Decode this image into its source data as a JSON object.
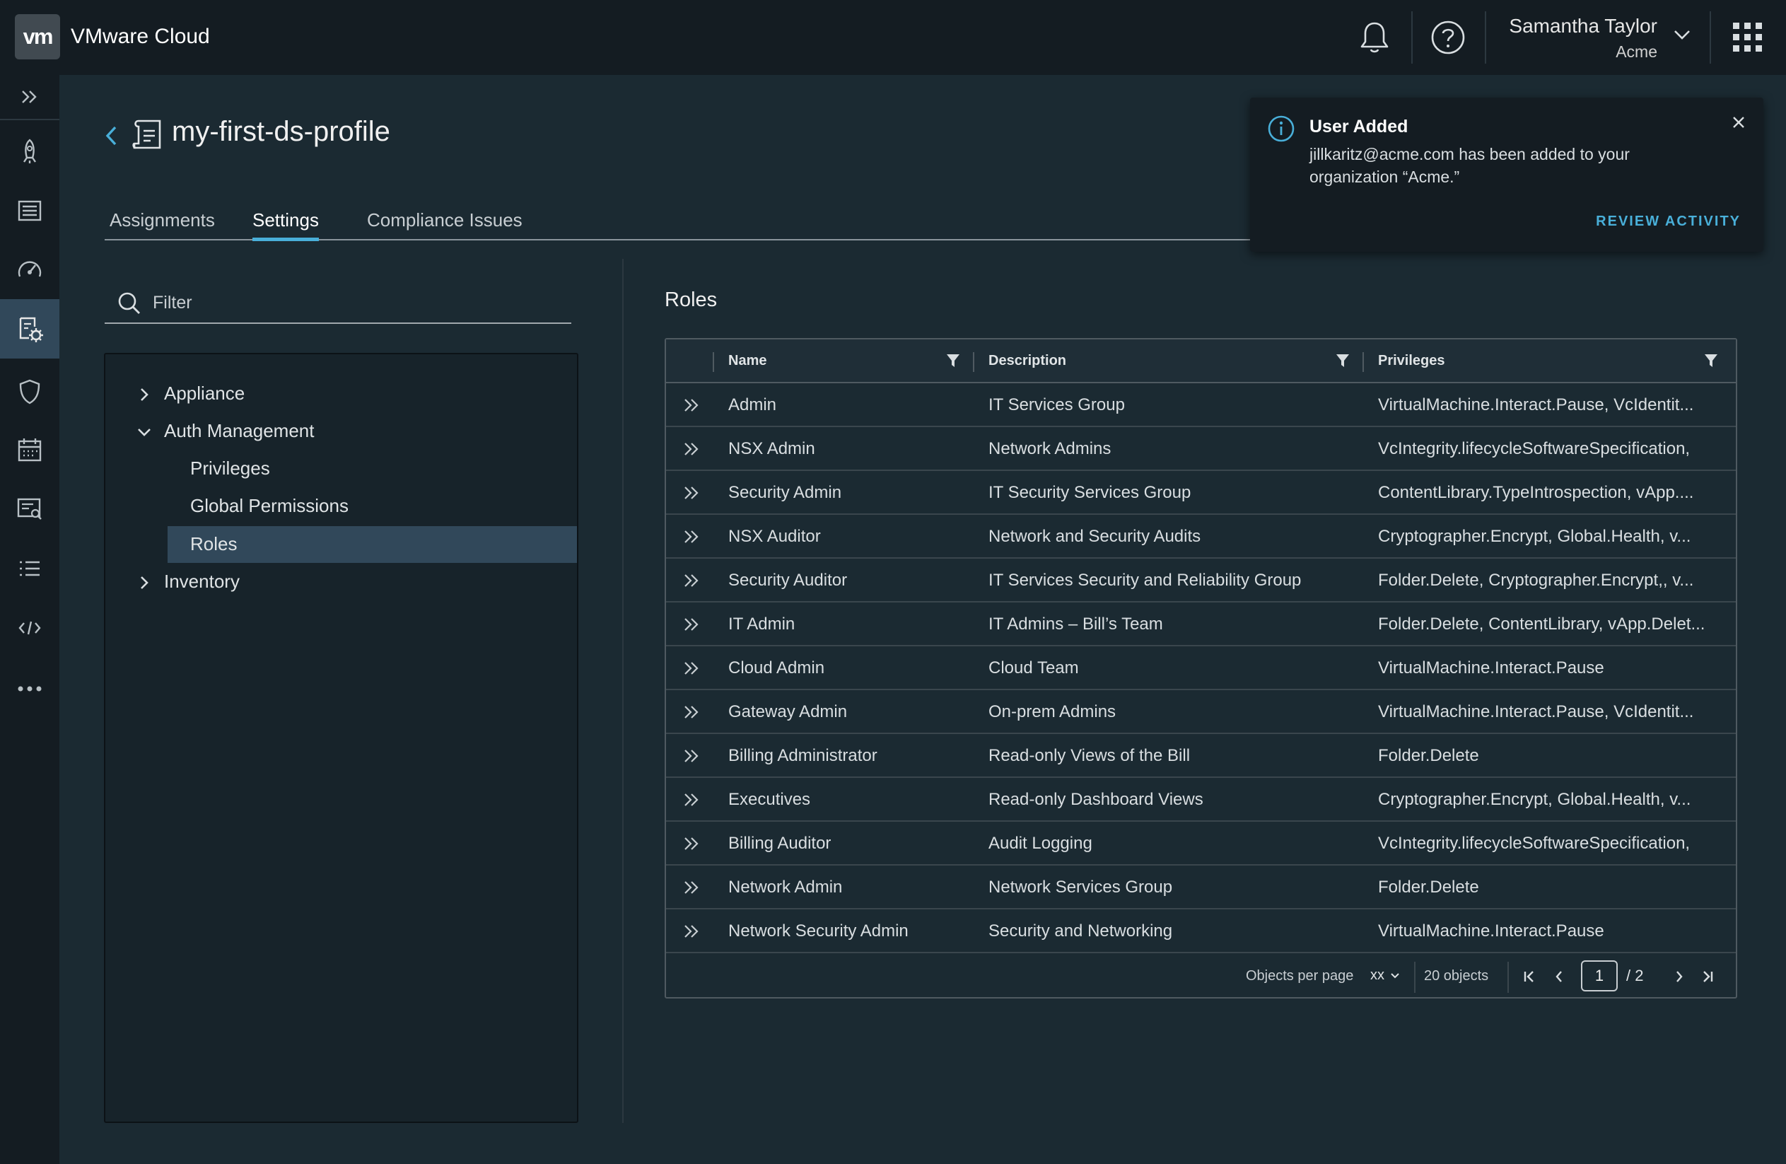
{
  "header": {
    "logo_text": "vm",
    "app_title": "VMware Cloud",
    "user_name": "Samantha Taylor",
    "user_org": "Acme",
    "icons": [
      "bell-icon",
      "help-icon",
      "chevron-down-icon",
      "app-grid-icon"
    ]
  },
  "leftnav": {
    "items": [
      "launch-icon",
      "catalog-icon",
      "dashboard-icon",
      "settings-profile-icon",
      "shield-icon",
      "calendar-icon",
      "search-list-icon",
      "list-icon",
      "code-icon",
      "more-icon"
    ],
    "active_index": 3
  },
  "page": {
    "title": "my-first-ds-profile"
  },
  "tabs": [
    {
      "label": "Assignments",
      "active": false
    },
    {
      "label": "Settings",
      "active": true
    },
    {
      "label": "Compliance Issues",
      "active": false
    }
  ],
  "filter": {
    "placeholder": "Filter"
  },
  "tree": [
    {
      "label": "Appliance",
      "expanded": false
    },
    {
      "label": "Auth Management",
      "expanded": true
    },
    {
      "label": "Privileges"
    },
    {
      "label": "Global Permissions"
    },
    {
      "label": "Roles",
      "selected": true
    },
    {
      "label": "Inventory",
      "expanded": false
    }
  ],
  "roles": {
    "title": "Roles",
    "columns": [
      "Name",
      "Description",
      "Privileges"
    ],
    "rows": [
      {
        "name": "Admin",
        "description": "IT Services Group",
        "privileges": "VirtualMachine.Interact.Pause, VcIdentit..."
      },
      {
        "name": "NSX Admin",
        "description": "Network Admins",
        "privileges": "VcIntegrity.lifecycleSoftwareSpecification,"
      },
      {
        "name": "Security Admin",
        "description": "IT Security Services Group",
        "privileges": "ContentLibrary.TypeIntrospection, vApp...."
      },
      {
        "name": "NSX Auditor",
        "description": "Network and Security Audits",
        "privileges": "Cryptographer.Encrypt, Global.Health, v..."
      },
      {
        "name": "Security Auditor",
        "description": "IT Services Security and Reliability Group",
        "privileges": "Folder.Delete, Cryptographer.Encrypt,, v..."
      },
      {
        "name": "IT Admin",
        "description": "IT Admins – Bill’s Team",
        "privileges": "Folder.Delete, ContentLibrary, vApp.Delet..."
      },
      {
        "name": "Cloud Admin",
        "description": "Cloud Team",
        "privileges": "VirtualMachine.Interact.Pause"
      },
      {
        "name": "Gateway Admin",
        "description": "On-prem Admins",
        "privileges": "VirtualMachine.Interact.Pause, VcIdentit..."
      },
      {
        "name": "Billing Administrator",
        "description": "Read-only Views of the Bill",
        "privileges": "Folder.Delete"
      },
      {
        "name": "Executives",
        "description": "Read-only Dashboard Views",
        "privileges": "Cryptographer.Encrypt, Global.Health, v..."
      },
      {
        "name": "Billing Auditor",
        "description": "Audit Logging",
        "privileges": "VcIntegrity.lifecycleSoftwareSpecification,"
      },
      {
        "name": "Network Admin",
        "description": "Network Services Group",
        "privileges": "Folder.Delete"
      },
      {
        "name": "Network Security Admin",
        "description": "Security and Networking",
        "privileges": "VirtualMachine.Interact.Pause"
      }
    ],
    "footer": {
      "per_page_label": "Objects per page",
      "per_page_value": "xx",
      "object_count": "20 objects",
      "current_page": "1",
      "total_pages": "/ 2"
    }
  },
  "toast": {
    "title": "User Added",
    "message": "jillkaritz@acme.com has been added to your organization “Acme.”",
    "action": "REVIEW ACTIVITY"
  },
  "colors": {
    "accent": "#49afd9",
    "background": "#1b2a32",
    "header": "#141c22",
    "selected": "#31485a"
  }
}
